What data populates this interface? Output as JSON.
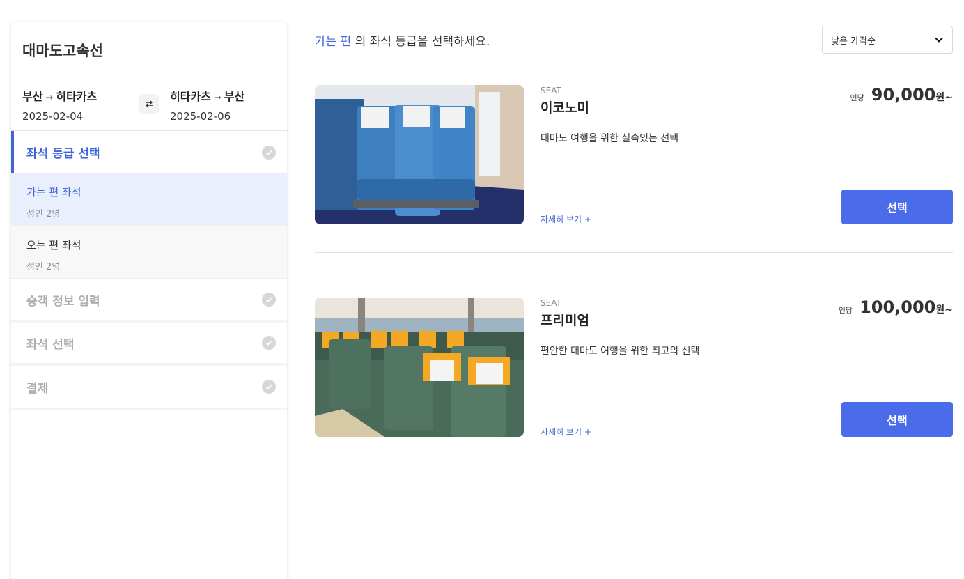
{
  "sidebar": {
    "title": "대마도고속선",
    "outbound": {
      "from": "부산",
      "to": "히타카츠",
      "date": "2025-02-04"
    },
    "return": {
      "from": "히타카츠",
      "to": "부산",
      "date": "2025-02-06"
    },
    "steps": [
      {
        "label": "좌석 등급 선택"
      },
      {
        "label": "승객 정보 입력"
      },
      {
        "label": "좌석 선택"
      },
      {
        "label": "결제"
      }
    ],
    "substeps": [
      {
        "label": "가는 편 좌석",
        "sub": "성인 2명"
      },
      {
        "label": "오는 편 좌석",
        "sub": "성인 2명"
      }
    ]
  },
  "heading": {
    "highlight": "가는 편",
    "rest": " 의 좌석 등급을 선택하세요."
  },
  "sort": {
    "selected": "낮은 가격순"
  },
  "seats": [
    {
      "kind": "SEAT",
      "name": "이코노미",
      "desc": "대마도 여행을 위한 실속있는 선택",
      "per": "인당",
      "price": "90,000",
      "unit": "원~",
      "more": "자세히 보기 +",
      "button": "선택"
    },
    {
      "kind": "SEAT",
      "name": "프리미엄",
      "desc": "편안한 대마도 여행을 위한 최고의 선택",
      "per": "인당",
      "price": "100,000",
      "unit": "원~",
      "more": "자세히 보기 +",
      "button": "선택"
    }
  ],
  "colors": {
    "accent": "#3f66d6",
    "button": "#4a6cea"
  },
  "icons": {
    "swap": "swap-arrows-icon",
    "check": "check-circle-icon",
    "sort": "chevron-down-icon"
  }
}
